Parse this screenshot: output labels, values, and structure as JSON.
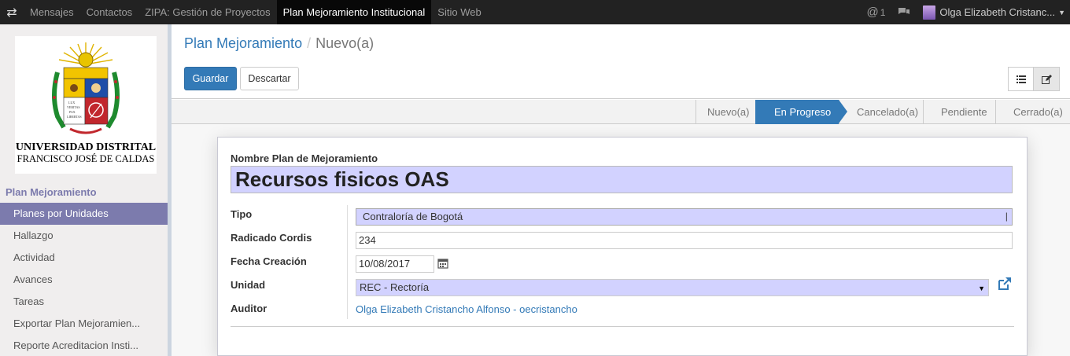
{
  "topbar": {
    "menu": [
      "Mensajes",
      "Contactos",
      "ZIPA: Gestión de Proyectos",
      "Plan Mejoramiento Institucional",
      "Sitio Web"
    ],
    "mentions_count": "1",
    "user_name": "Olga Elizabeth Cristanc..."
  },
  "sidebar": {
    "logo_line1": "UNIVERSIDAD DISTRITAL",
    "logo_line2": "FRANCISCO JOSÉ DE CALDAS",
    "section": "Plan Mejoramiento",
    "items": [
      "Planes por Unidades",
      "Hallazgo",
      "Actividad",
      "Avances",
      "Tareas",
      "Exportar Plan Mejoramien...",
      "Reporte Acreditacion Insti..."
    ]
  },
  "breadcrumb": {
    "parent": "Plan Mejoramiento",
    "separator": "/",
    "current": "Nuevo(a)"
  },
  "buttons": {
    "save": "Guardar",
    "discard": "Descartar"
  },
  "stages": [
    "Nuevo(a)",
    "En Progreso",
    "Cancelado(a)",
    "Pendiente",
    "Cerrado(a)"
  ],
  "form": {
    "name_label": "Nombre Plan de Mejoramiento",
    "name_value": "Recursos fisicos OAS",
    "tipo_label": "Tipo",
    "tipo_value": "Contraloría de Bogotá",
    "radicado_label": "Radicado Cordis",
    "radicado_value": "234",
    "fecha_label": "Fecha Creación",
    "fecha_value": "10/08/2017",
    "unidad_label": "Unidad",
    "unidad_value": "REC - Rectoría",
    "auditor_label": "Auditor",
    "auditor_value": "Olga Elizabeth Cristancho Alfonso - oecristancho"
  },
  "colors": {
    "primary": "#337ab7",
    "sidebar_accent": "#7c7bad",
    "required_field": "#d2d2ff"
  }
}
